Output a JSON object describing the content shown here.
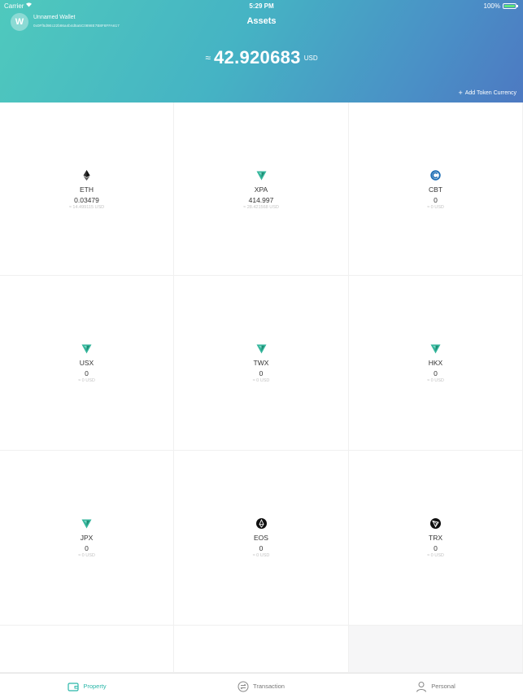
{
  "status_bar": {
    "carrier": "Carrier",
    "time": "5:29 PM",
    "battery": "100%"
  },
  "header": {
    "wallet_initial": "W",
    "wallet_name": "Unnamed Wallet",
    "wallet_address": "0x0Ff5d9Ec22b86a4b4d5a5C0898E7B8F8FFA617",
    "title": "Assets",
    "approx": "≈",
    "total": "42.920683",
    "currency": "USD",
    "add_token": "Add Token Currency"
  },
  "tokens": [
    {
      "symbol": "ETH",
      "balance": "0.03479",
      "usd": "≈ 14.499115 USD",
      "icon": "ethereum-icon"
    },
    {
      "symbol": "XPA",
      "balance": "414.997",
      "usd": "≈ 28.421568 USD",
      "icon": "xpa-icon"
    },
    {
      "symbol": "CBT",
      "balance": "0",
      "usd": "≈ 0 USD",
      "icon": "cbt-icon"
    },
    {
      "symbol": "USX",
      "balance": "0",
      "usd": "≈ 0 USD",
      "icon": "xpa-icon"
    },
    {
      "symbol": "TWX",
      "balance": "0",
      "usd": "≈ 0 USD",
      "icon": "xpa-icon"
    },
    {
      "symbol": "HKX",
      "balance": "0",
      "usd": "≈ 0 USD",
      "icon": "xpa-icon"
    },
    {
      "symbol": "JPX",
      "balance": "0",
      "usd": "≈ 0 USD",
      "icon": "xpa-icon"
    },
    {
      "symbol": "EOS",
      "balance": "0",
      "usd": "≈ 0 USD",
      "icon": "eos-icon"
    },
    {
      "symbol": "TRX",
      "balance": "0",
      "usd": "≈ 0 USD",
      "icon": "tron-icon"
    }
  ],
  "tabbar": {
    "property": "Property",
    "transaction": "Transaction",
    "personal": "Personal"
  },
  "colors": {
    "accent": "#2ab7a9",
    "header_start": "#4fc9bd",
    "header_end": "#4d79c2"
  }
}
